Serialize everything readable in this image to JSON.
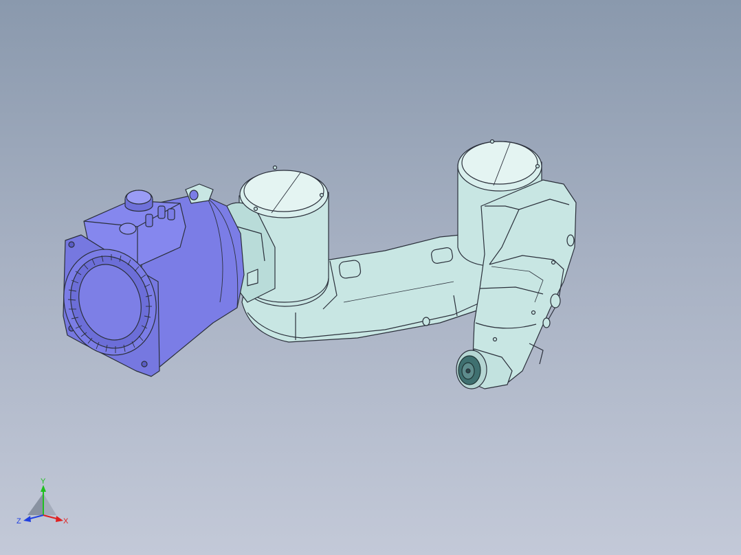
{
  "colors": {
    "background_top": "#8a99ad",
    "background_bottom": "#c3c9d8",
    "robot_body": "#c8e6e3",
    "robot_shadow": "#a9cfcc",
    "motor_body": "#7b7de6",
    "motor_dark": "#5a5cc4",
    "edge_line": "#2a2f3a",
    "axis_x": "#e02020",
    "axis_y": "#20c020",
    "axis_z": "#2040e0"
  },
  "icons": {
    "view_triad": "xyz-triad-icon"
  },
  "triad": {
    "x_label": "X",
    "y_label": "Y",
    "z_label": "Z"
  }
}
